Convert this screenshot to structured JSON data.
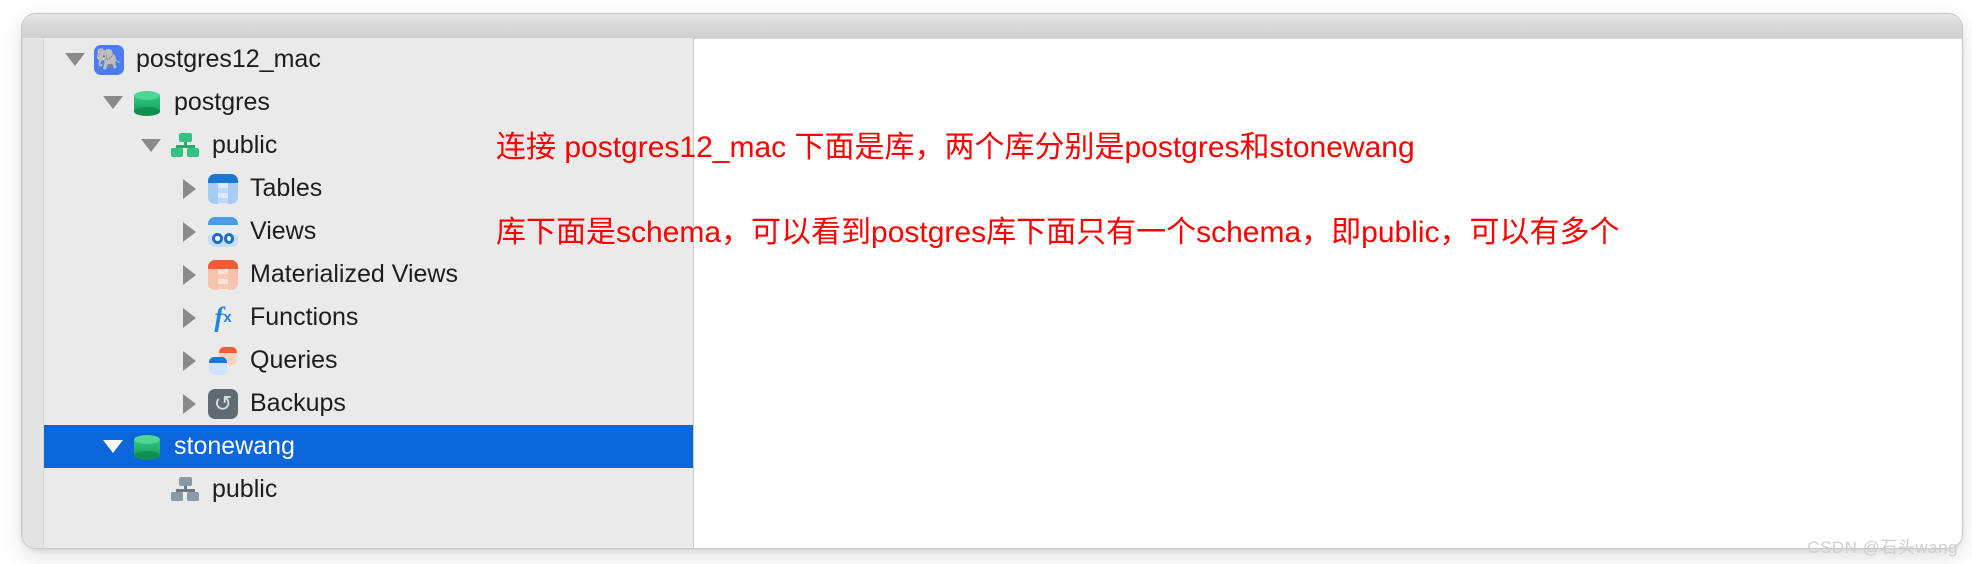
{
  "window": {
    "titlebar_label": ""
  },
  "tree": {
    "rows": [
      {
        "label": "postgres12_mac",
        "icon": "postgres-server-icon",
        "twisty": "down",
        "indent": 0,
        "selected": false
      },
      {
        "label": "postgres",
        "icon": "database-icon",
        "twisty": "down",
        "indent": 1,
        "selected": false
      },
      {
        "label": "public",
        "icon": "schema-icon",
        "twisty": "down",
        "indent": 2,
        "selected": false
      },
      {
        "label": "Tables",
        "icon": "tables-icon",
        "twisty": "right",
        "indent": 3,
        "selected": false
      },
      {
        "label": "Views",
        "icon": "views-icon",
        "twisty": "right",
        "indent": 3,
        "selected": false
      },
      {
        "label": "Materialized Views",
        "icon": "materialized-views-icon",
        "twisty": "right",
        "indent": 3,
        "selected": false
      },
      {
        "label": "Functions",
        "icon": "functions-icon",
        "twisty": "right",
        "indent": 3,
        "selected": false
      },
      {
        "label": "Queries",
        "icon": "queries-icon",
        "twisty": "right",
        "indent": 3,
        "selected": false
      },
      {
        "label": "Backups",
        "icon": "backups-icon",
        "twisty": "right",
        "indent": 3,
        "selected": false
      },
      {
        "label": "stonewang",
        "icon": "database-icon",
        "twisty": "down",
        "indent": 1,
        "selected": true
      },
      {
        "label": "public",
        "icon": "schema-icon-gray",
        "twisty": "none",
        "indent": 2,
        "selected": false
      }
    ]
  },
  "annotations": {
    "line1": "连接 postgres12_mac 下面是库，两个库分别是postgres和stonewang",
    "line2": "库下面是schema，可以看到postgres库下面只有一个schema，即public，可以有多个",
    "color": "#fe0000"
  },
  "watermark": {
    "text": "CSDN @石头wang"
  },
  "colors": {
    "selection_blue": "#0a66da",
    "sidebar_bg": "#eaeaea",
    "content_bg": "#ffffff"
  }
}
